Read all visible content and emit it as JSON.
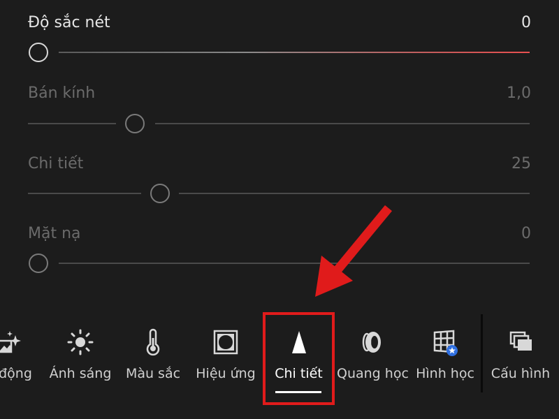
{
  "sliders": [
    {
      "label": "Độ sắc nét",
      "value": "0",
      "position": 0.0,
      "active": true
    },
    {
      "label": "Bán kính",
      "value": "1,0",
      "position": 0.21,
      "active": false
    },
    {
      "label": "Chi tiết",
      "value": "25",
      "position": 0.25,
      "active": false
    },
    {
      "label": "Mặt nạ",
      "value": "0",
      "position": 0.0,
      "active": false
    }
  ],
  "toolbar": {
    "items": [
      {
        "label": "động",
        "icon": "auto-icon"
      },
      {
        "label": "Ánh sáng",
        "icon": "sun-icon"
      },
      {
        "label": "Màu sắc",
        "icon": "thermometer-icon"
      },
      {
        "label": "Hiệu ứng",
        "icon": "vignette-icon"
      },
      {
        "label": "Chi tiết",
        "icon": "triangle-icon",
        "active": true
      },
      {
        "label": "Quang học",
        "icon": "lens-icon"
      },
      {
        "label": "Hình học",
        "icon": "geometry-icon"
      },
      {
        "label": "Cấu hình",
        "icon": "profile-icon"
      }
    ]
  },
  "colors": {
    "highlight": "#e01b1b",
    "accent_track": "#e85050"
  }
}
